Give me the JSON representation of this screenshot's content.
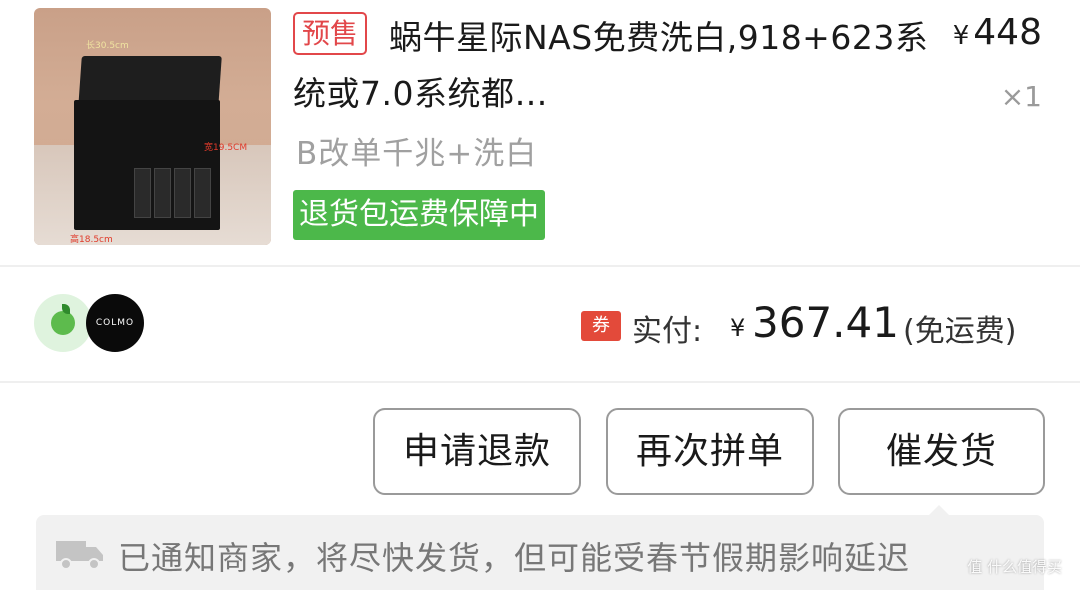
{
  "product": {
    "presale_badge": "预售",
    "title": "蜗牛星际NAS免费洗白,918+623系统或7.0系统都…",
    "price_symbol": "¥",
    "price": "448",
    "quantity": "×1",
    "variant": "B改单千兆+洗白",
    "guarantee": "退货包运费保障中",
    "image_labels": {
      "width": "宽19.5CM",
      "depth": "高18.5cm",
      "top": "长30.5cm"
    }
  },
  "payment": {
    "coupon_icon": "券",
    "label": "实付:",
    "currency": "¥",
    "amount": "367.41",
    "note": "(免运费)",
    "brand_logo_text": "COLMO"
  },
  "actions": {
    "refund": "申请退款",
    "reorder": "再次拼单",
    "urge": "催发货"
  },
  "notice": {
    "icon": "truck-icon",
    "text": "已通知商家，将尽快发货，但可能受春节假期影响延迟"
  },
  "watermark": "值 什么值得买"
}
